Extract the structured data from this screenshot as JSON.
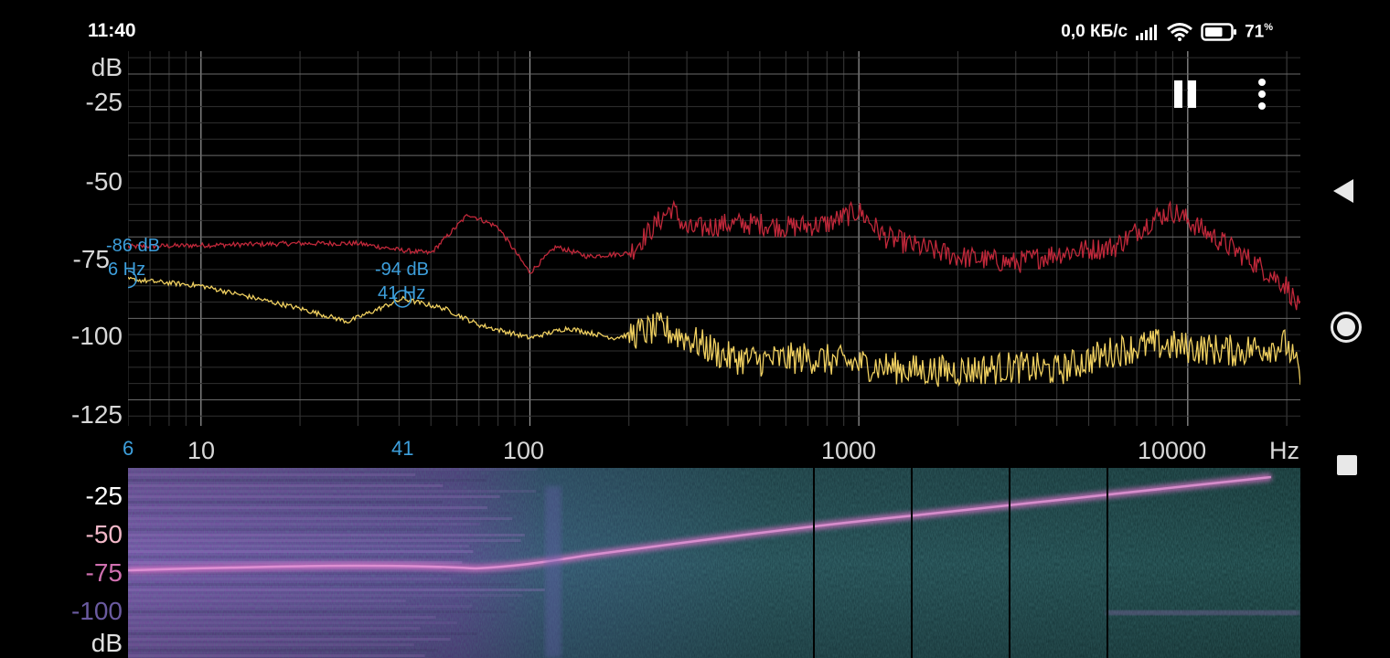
{
  "status_bar": {
    "time": "11:40",
    "network_speed": "0,0 КБ/с",
    "battery_percent": "71",
    "battery_unit": "%",
    "battery_level": 0.71
  },
  "spectrum": {
    "y_unit": "dB",
    "y_ticks": [
      "-25",
      "-50",
      "-75",
      "-100",
      "-125"
    ],
    "x_ticks": [
      "10",
      "100",
      "1000",
      "10000"
    ],
    "x_unit": "Hz",
    "cursor_markers": [
      {
        "db_text": "-86 dB",
        "hz_text": "6 Hz",
        "axis_label": "6",
        "color": "#3d9fdc"
      },
      {
        "db_text": "-94 dB",
        "hz_text": "41 Hz",
        "axis_label": "41",
        "color": "#3d9fdc"
      }
    ],
    "series_colors": {
      "peak": "#c0283a",
      "current": "#f0d060"
    }
  },
  "spectrogram": {
    "y_ticks": [
      "-25",
      "-50",
      "-75",
      "-100"
    ],
    "y_unit": "dB",
    "tick_colors": [
      "#ffffff",
      "#f2b8c8",
      "#d070b0",
      "#6a5aa0"
    ]
  },
  "icons": {
    "pause": "pause-icon",
    "more": "more-vert-icon",
    "back": "nav-back-icon",
    "home": "nav-home-icon",
    "recents": "nav-recents-icon"
  }
}
